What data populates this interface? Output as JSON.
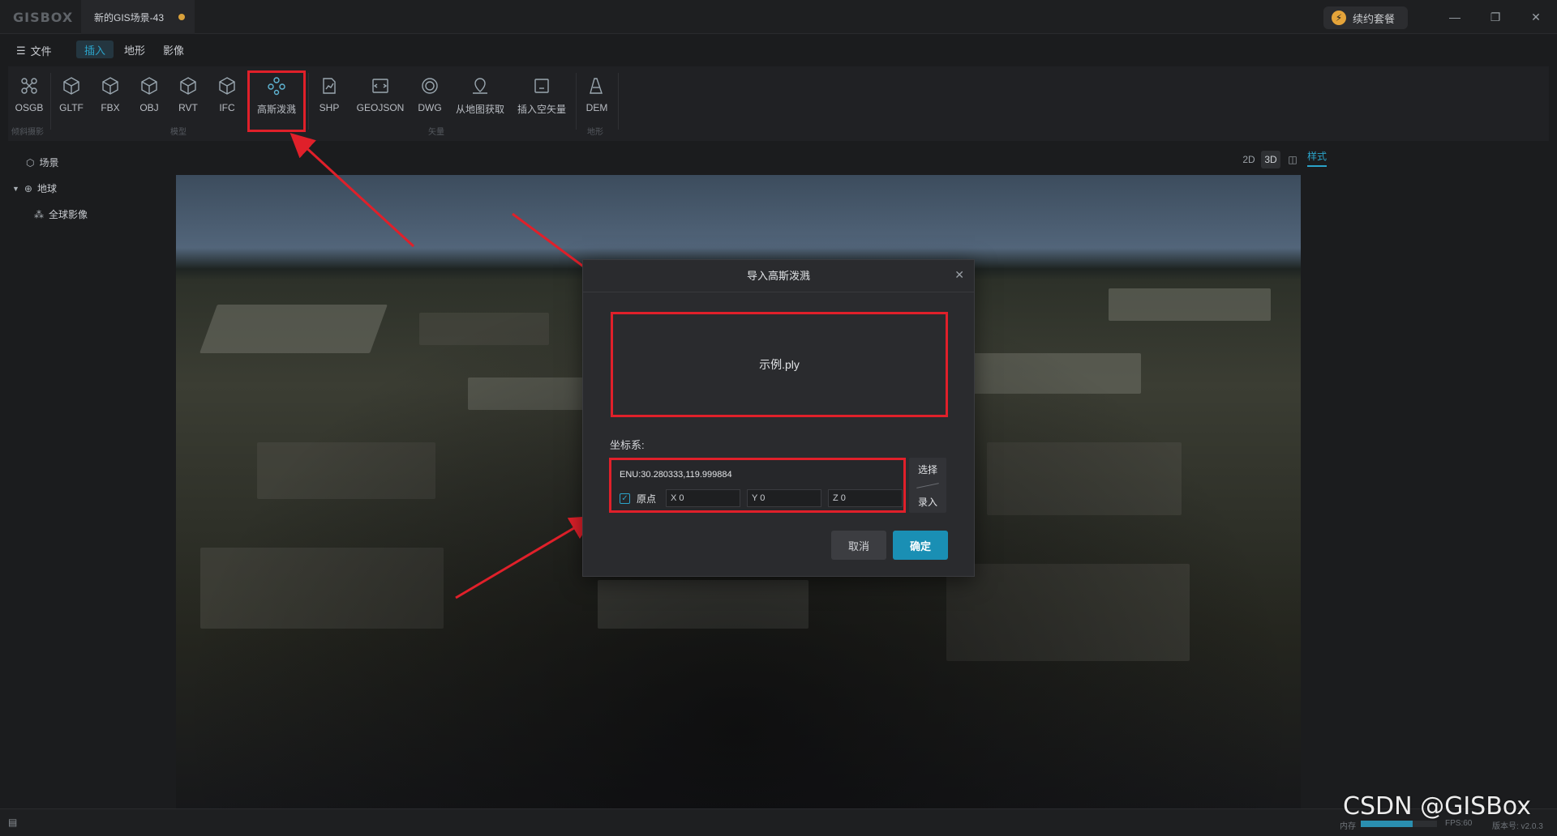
{
  "app": {
    "logo": "GISBOX",
    "document_tab": "新的GIS场景-43",
    "renew_label": "续约套餐"
  },
  "menu": {
    "file_label": "文件",
    "tabs": [
      "插入",
      "地形",
      "影像"
    ],
    "active_tab": "插入"
  },
  "ribbon": {
    "tools": [
      {
        "label": "OSGB",
        "icon": "osgb-icon"
      },
      {
        "label": "GLTF",
        "icon": "cube-icon"
      },
      {
        "label": "FBX",
        "icon": "cube-icon"
      },
      {
        "label": "OBJ",
        "icon": "cube-icon"
      },
      {
        "label": "RVT",
        "icon": "cube-icon"
      },
      {
        "label": "IFC",
        "icon": "cube-icon"
      },
      {
        "label": "高斯泼溅",
        "icon": "gaussian-splat-icon"
      },
      {
        "label": "SHP",
        "icon": "shp-icon"
      },
      {
        "label": "GEOJSON",
        "icon": "geojson-icon"
      },
      {
        "label": "DWG",
        "icon": "dwg-icon"
      },
      {
        "label": "从地图获取",
        "icon": "map-pin-icon"
      },
      {
        "label": "插入空矢量",
        "icon": "empty-vector-icon"
      },
      {
        "label": "DEM",
        "icon": "dem-icon"
      }
    ],
    "groups": [
      "倾斜摄影",
      "模型",
      "矢量",
      "地形"
    ]
  },
  "tree": {
    "scene": "场景",
    "earth": "地球",
    "global_imagery": "全球影像"
  },
  "view_toggles": [
    "2D",
    "3D",
    "split"
  ],
  "style_tab": "样式",
  "dialog": {
    "title": "导入高斯泼溅",
    "file_name": "示例.ply",
    "crs_label": "坐标系:",
    "crs_value": "ENU:30.280333,119.999884",
    "origin_label": "原点",
    "origin_checked": true,
    "x_value": "X 0",
    "y_value": "Y 0",
    "z_value": "Z 0",
    "select_label": "选择",
    "input_label": "录入",
    "cancel_label": "取消",
    "ok_label": "确定"
  },
  "status": {
    "memory_label": "内存",
    "memory_fraction": 0.68,
    "fps_label": "FPS:60",
    "version_label": "版本号: v2.0.3"
  },
  "watermark": "CSDN @GISBox",
  "colors": {
    "accent": "#1a8fb4",
    "highlight_box": "#e0202a",
    "background": "#1b1c1e"
  }
}
